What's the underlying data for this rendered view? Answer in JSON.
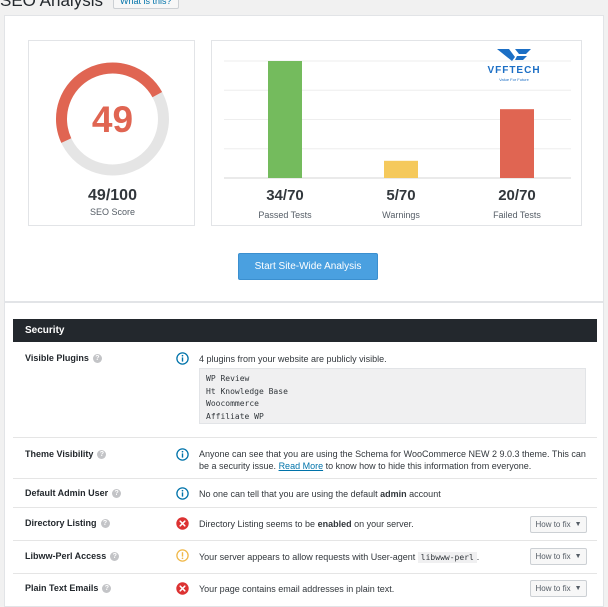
{
  "header": {
    "title": "SEO Analysis",
    "whatis_label": "What is this?"
  },
  "score": {
    "value": "49",
    "display": "49/100",
    "label": "SEO Score",
    "fraction": 0.49,
    "color": "#e06552"
  },
  "logo": {
    "name": "VFFTECH",
    "tagline": "Value For Future"
  },
  "chart_data": {
    "type": "bar",
    "categories": [
      "Passed Tests",
      "Warnings",
      "Failed Tests"
    ],
    "values": [
      34,
      5,
      20
    ],
    "totals": [
      70,
      70,
      70
    ],
    "labels": [
      "34/70",
      "5/70",
      "20/70"
    ],
    "colors": [
      "#74bb5d",
      "#f5c95c",
      "#e06552"
    ],
    "ylim": [
      0,
      34
    ],
    "grid": true
  },
  "actions": {
    "analyze_label": "Start Site-Wide Analysis"
  },
  "security": {
    "title": "Security",
    "rows": [
      {
        "title": "Visible Plugins",
        "status": "info",
        "text": "4 plugins from your website are publicly visible.",
        "plugins": [
          "WP Review",
          "Ht Knowledge Base",
          "Woocommerce",
          "Affiliate WP"
        ]
      },
      {
        "title": "Theme Visibility",
        "status": "info",
        "text_before": "Anyone can see that you are using the Schema for WooCommerce NEW 2 9.0.3 theme. This can be a security issue.",
        "link": "Read More",
        "text_after": "to know how to hide this information from everyone."
      },
      {
        "title": "Default Admin User",
        "status": "info",
        "text_before": "No one can tell that you are using the default",
        "bold": "admin",
        "text_after": "account"
      },
      {
        "title": "Directory Listing",
        "status": "fail",
        "text_before": "Directory Listing seems to be",
        "bold": "enabled",
        "text_after": "on your server.",
        "action": "How to fix"
      },
      {
        "title": "Libww-Perl Access",
        "status": "warn",
        "text_before": "Your server appears to allow requests with User-agent",
        "code": "libwww-perl",
        "text_after": ".",
        "action": "How to fix"
      },
      {
        "title": "Plain Text Emails",
        "status": "fail",
        "text": "Your page contains email addresses in plain text.",
        "action": "How to fix"
      }
    ]
  },
  "colors": {
    "info": "#0073aa",
    "fail": "#dc3232",
    "warn": "#f5c95c",
    "accent": "#4aa0e0",
    "header_dark": "#23282d"
  },
  "icons": {
    "help": "question-circle-icon",
    "info": "info-circle-icon",
    "fail": "x-circle-icon",
    "warn": "exclamation-circle-icon",
    "caret": "caret-down-icon"
  }
}
